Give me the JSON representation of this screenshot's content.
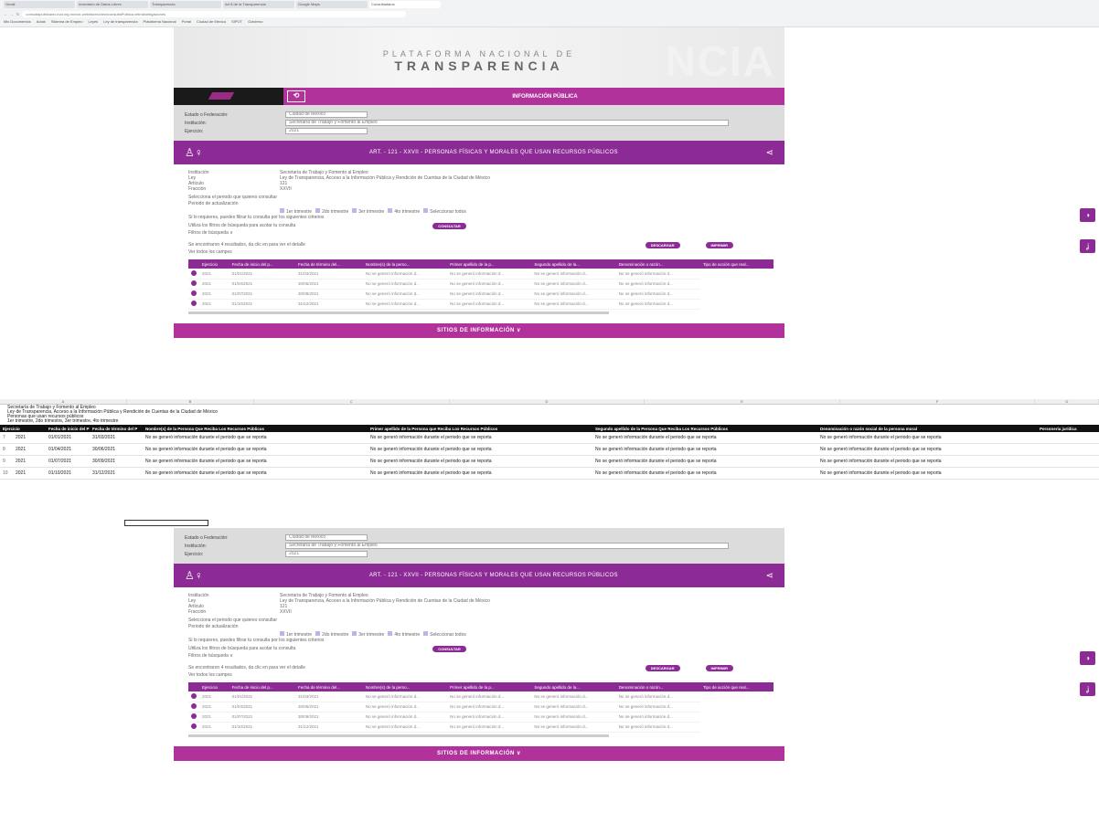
{
  "browser": {
    "tabs": [
      "Gmail",
      "Inventario de Datos Libres",
      "Transparencia",
      "Art 8 de la Transparencia",
      "Google Maps",
      "Consultadatos"
    ],
    "url": "consultapublicamx.inai.org.mx/vut-web/faces/view/consultaPublica.xhtml#obligaciones",
    "bookmarks": [
      "Mis Documentos",
      "Actas",
      "Sistema de Empleo",
      "Leyes",
      "Ley de transparencia",
      "Plataforma Nacional",
      "Portal",
      "Ciudad de Mexico",
      "SIPOT",
      "Gobierno"
    ]
  },
  "portal": {
    "hero_sub": "PLATAFORMA NACIONAL DE",
    "hero_title": "TRANSPARENCIA",
    "hero_ghost": "NCIA",
    "nav_label": "INFORMACIÓN PÚBLICA",
    "filters": {
      "estado_label": "Estado o Federación:",
      "estado_value": "Ciudad de México",
      "institucion_label": "Institución:",
      "institucion_value": "Secretaría de Trabajo y Fomento al Empleo",
      "ejercicio_label": "Ejercicio:",
      "ejercicio_value": "2021"
    },
    "band_title": "ART. - 121 - XXVII - PERSONAS FÍSICAS Y MORALES QUE USAN RECURSOS PÚBLICOS",
    "info": [
      {
        "k": "Institución",
        "v": "Secretaría de Trabajo y Fomento al Empleo"
      },
      {
        "k": "Ley",
        "v": "Ley de Transparencia, Acceso a la Información Pública y Rendición de Cuentas de la Ciudad de México"
      },
      {
        "k": "Artículo",
        "v": "121"
      },
      {
        "k": "Fracción",
        "v": "XXVII"
      }
    ],
    "periodo_title": "Selecciona el periodo que quieres consultar",
    "periodo_label": "Periodo de actualización",
    "checkboxes": [
      "1er trimestre",
      "2do trimestre",
      "3er trimestre",
      "4to trimestre",
      "Seleccionar todos"
    ],
    "line1": "Si lo requieres, puedes filtrar tu consulta por los siguientes criterios",
    "line2": "Utiliza los filtros de búsqueda para acotar tu consulta",
    "consultar": "CONSULTAR",
    "filtros_link": "Filtros de búsqueda ∨",
    "results_text": "Se encontraron 4 resultados, da clic en  para ver el detalle",
    "descargar": "DESCARGAR",
    "imprimir": "IMPRIMIR",
    "ver_todos": "Ver todos los campos",
    "table_headers": [
      "",
      "Ejercicio",
      "Fecha de inicio del p...",
      "Fecha de término del...",
      "Nombre(s) de la perso...",
      "Primer apellido de la p...",
      "Segundo apellido de la...",
      "Denominación o razón...",
      "Tipo de acción que real..."
    ],
    "table_rows": [
      [
        "2021",
        "01/01/2021",
        "31/03/2021",
        "No se generó información d...",
        "No se generó información d...",
        "No se generó información d...",
        "No se generó información d..."
      ],
      [
        "2021",
        "01/04/2021",
        "30/06/2021",
        "No se generó información d...",
        "No se generó información d...",
        "No se generó información d...",
        "No se generó información d..."
      ],
      [
        "2021",
        "01/07/2021",
        "30/09/2021",
        "No se generó información d...",
        "No se generó información d...",
        "No se generó información d...",
        "No se generó información d..."
      ],
      [
        "2021",
        "01/10/2021",
        "31/12/2021",
        "No se generó información d...",
        "No se generó información d...",
        "No se generó información d...",
        "No se generó información d..."
      ]
    ],
    "footer": "SITIOS DE INFORMACIÓN ∨"
  },
  "side_icons": [
    "◑",
    "ʝ"
  ],
  "sheet": {
    "columns": [
      "A",
      "B",
      "C",
      "D",
      "E",
      "F",
      "G"
    ],
    "meta": [
      "Secretaría de Trabajo y Fomento al Empleo",
      "Ley de Transparencia, Acceso a la Información Pública y Rendición de Cuentas de la Ciudad de México",
      "Personas que usan recursos públicos",
      "1er trimestre, 2do trimestre, 3er trimestre, 4to trimestre"
    ],
    "headers": [
      "Ejercicio",
      "Fecha de inicio del P",
      "Fecha de término del P",
      "Nombre(s) de la Persona Que Reciba Los Recursos Públicos",
      "Primer apellido de la Persona que Reciba Los Recursos Públicos",
      "Segundo apellido de la Persona Que Reciba Los Recursos Públicos",
      "Denominación o razón social de la persona moral",
      "Personería jurídica"
    ],
    "rows": [
      [
        "7",
        "2021",
        "01/01/2021",
        "31/03/2021",
        "No se generó información durante el periodo que se reporta",
        "No se generó información durante el periodo que se reporta",
        "No se generó información durante el periodo que se reporta",
        "No se generó información durante el periodo que se reporta"
      ],
      [
        "8",
        "2021",
        "01/04/2021",
        "30/06/2021",
        "No se generó información durante el periodo que se reporta",
        "No se generó información durante el periodo que se reporta",
        "No se generó información durante el periodo que se reporta",
        "No se generó información durante el periodo que se reporta"
      ],
      [
        "9",
        "2021",
        "01/07/2021",
        "30/09/2021",
        "No se generó información durante el periodo que se reporta",
        "No se generó información durante el periodo que se reporta",
        "No se generó información durante el periodo que se reporta",
        "No se generó información durante el periodo que se reporta"
      ],
      [
        "10",
        "2021",
        "01/10/2021",
        "31/12/2021",
        "No se generó información durante el periodo que se reporta",
        "No se generó información durante el periodo que se reporta",
        "No se generó información durante el periodo que se reporta",
        "No se generó información durante el periodo que se reporta"
      ]
    ]
  }
}
